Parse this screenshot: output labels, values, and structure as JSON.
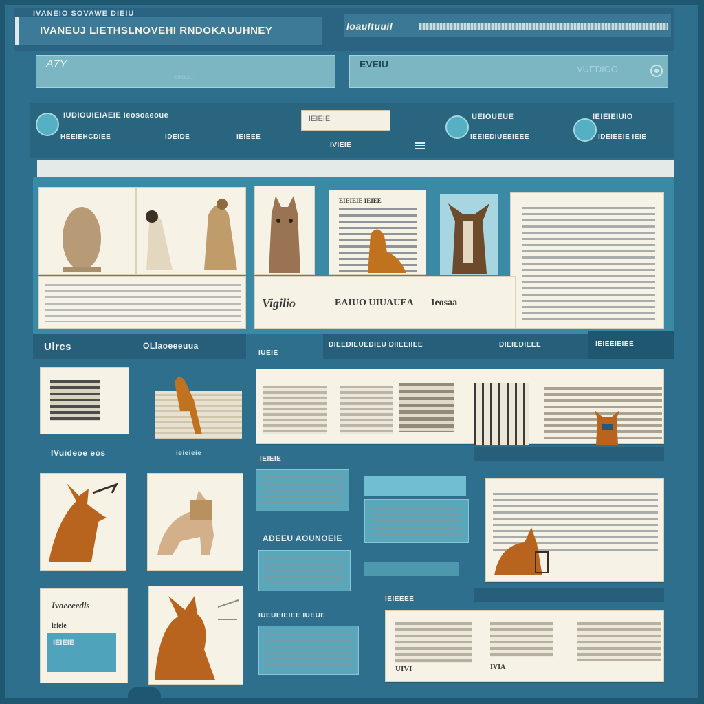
{
  "header": {
    "app_label": "IVANEIO SOVAWE DIEIU",
    "page_title": "IVANEUJ LIETHSLNOVEHI RNDOKAUUHNEY",
    "account_label": "Ioaultuuil"
  },
  "search": {
    "left_value": "A7Y",
    "left_placeholder": "aeouu",
    "right_value": "EVEIU",
    "right_placeholder": "VUEDIOO"
  },
  "nav": {
    "headline": "IUDIOUIEIAEIE Ieosoaeoue",
    "sub_1": "HEEIEHCDIEE",
    "sub_2": "IDEIDE",
    "sub_3": "IEIEEE",
    "search_placeholder": "IEIEIE",
    "mid_label": "IVIEIE",
    "badge_1_title": "UEIOUEUE",
    "badge_1_sub": "IEEIEDIUEEIEEE",
    "badge_2_title": "IEIEIEIUIO",
    "badge_2_sub": "IDEIEEIE IEIE"
  },
  "gallery": {
    "caption_script": "Vigilio",
    "caption_main": "EAIUO UIUAUEA",
    "caption_end": "Ieosaa",
    "story_heading": "EIEIEIE IEIEE"
  },
  "sections": {
    "left_label": "Ulrcs",
    "mid_label": "OLlaoeeeuua",
    "small_label": "IUEIE",
    "right_label_1": "DIEEDIEUEDIEU DIIEEIIEE",
    "right_label_2": "DIEIEDIEEE",
    "right_label_3": "IEIEEIEIEE"
  },
  "content": {
    "feature_label": "IVuideoe eos",
    "feature_sub": "ieieieie",
    "list_label": "IEIEIE",
    "search_label": "ADEEU AOUNOEIE",
    "latest_label": "IEIEEEE",
    "bottom_left_label": "IUEUEIEIEE IUEUE",
    "foot_1": "UIVI",
    "foot_2": "IVIA",
    "card_title": "Ivoeeeedis",
    "card_sub": "ieieie",
    "tag_label": "IEIEIE"
  },
  "colors": {
    "background": "#2f6f8e",
    "header": "#2a6482",
    "accent": "#55b0c4",
    "paper": "#f3efe3",
    "animal": "#b8641e"
  },
  "icons": [
    "user-icon",
    "search-icon",
    "globe-icon",
    "compass-icon",
    "menu-icon"
  ]
}
